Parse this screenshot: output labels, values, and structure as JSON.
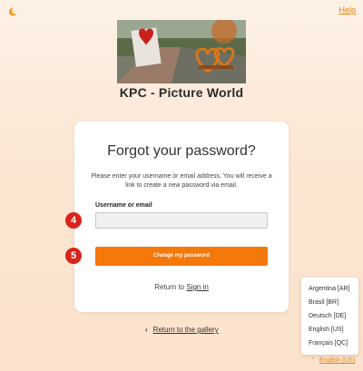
{
  "header": {
    "help_label": "Help",
    "site_title": "KPC - Picture World"
  },
  "card": {
    "title": "Forgot your password?",
    "description": "Please enter your username or email address. You will receive a link to create a new password via email.",
    "field_label": "Username or email",
    "field_value": "",
    "submit_label": "Change my password",
    "return_prefix": "Return to",
    "signin_label": "Sign in"
  },
  "badges": {
    "field": "4",
    "button": "5"
  },
  "footer": {
    "gallery_label": "Return to the gallery",
    "language_selected": "English (US)",
    "languages": [
      "Argentina [AR]",
      "Brasil [BR]",
      "Deutsch [DE]",
      "English [US]",
      "Français [QC]"
    ]
  },
  "colors": {
    "accent": "#f5780a",
    "link": "#e8820c",
    "badge": "#d9241b"
  },
  "icons": {
    "logo": "moon-logo-icon",
    "gallery": "chevron-left-icon",
    "language": "chevron-up-icon"
  }
}
